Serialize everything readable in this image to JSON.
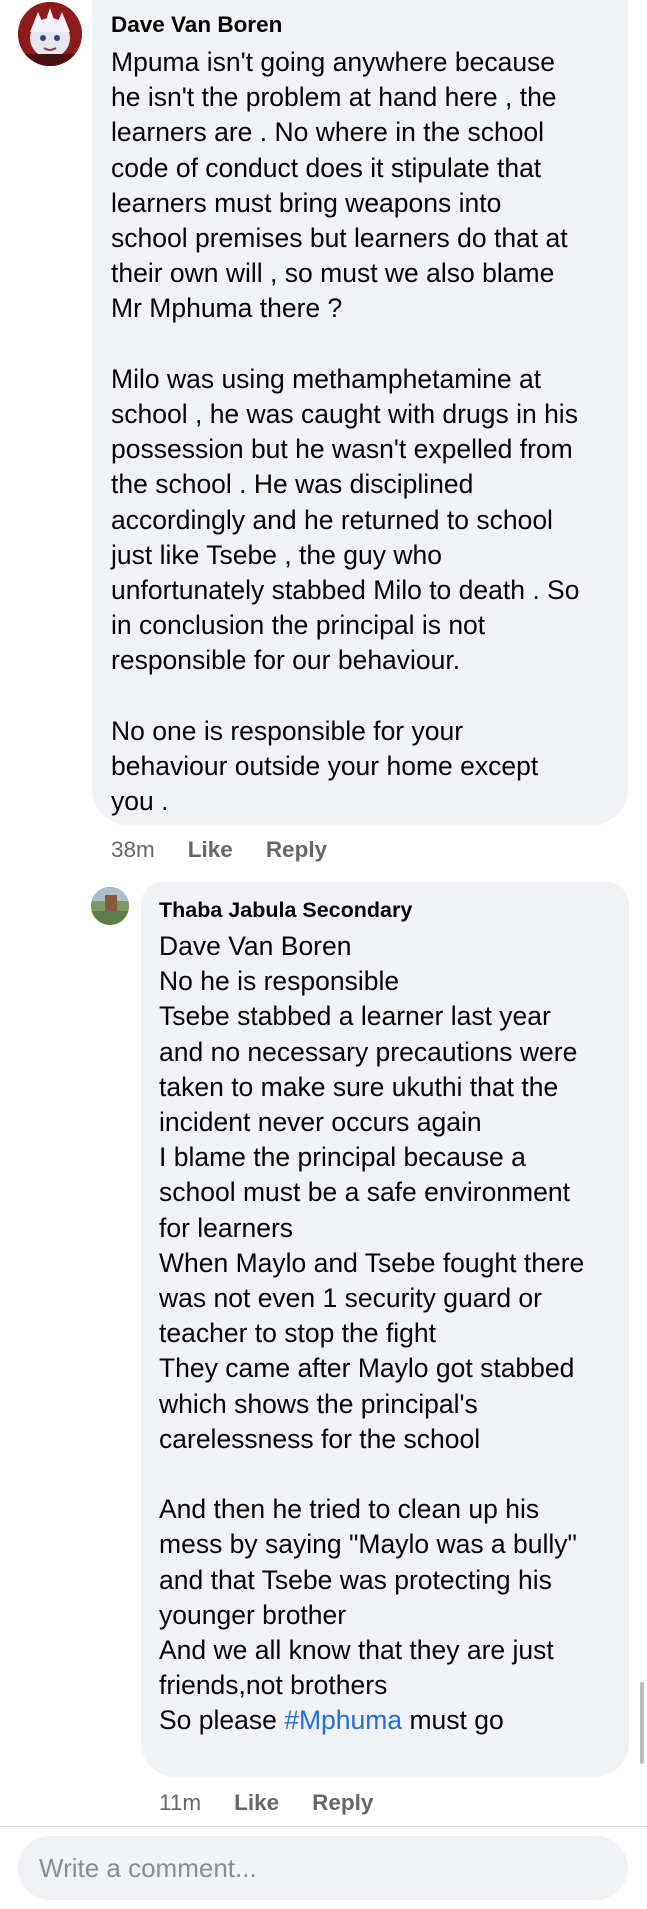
{
  "comments": [
    {
      "author": "Dave Van Boren",
      "body": "Mpuma isn't going anywhere because\nhe isn't the problem at hand here , the\nlearners are . No where in the school\ncode of conduct does it stipulate that\nlearners must bring weapons into\nschool premises but learners do that at\ntheir own will , so must we also blame\nMr Mphuma there ?\n\nMilo was using methamphetamine at\nschool , he was caught with drugs in his\npossession but he wasn't expelled from\nthe school . He was disciplined\naccordingly and he returned to school\njust like Tsebe , the guy who\nunfortunately stabbed Milo to death . So\nin conclusion the principal is not\nresponsible for our behaviour.\n\nNo one is responsible for your\nbehaviour outside your home except\nyou .",
      "time": "38m",
      "like_label": "Like",
      "reply_label": "Reply"
    }
  ],
  "reply": {
    "author": "Thaba Jabula Secondary",
    "body": "Dave Van Boren\nNo he is responsible\nTsebe stabbed a learner last year\nand no necessary precautions were\ntaken to make sure ukuthi that the\nincident never occurs again\nI blame the principal because a\nschool must be a safe environment\nfor learners\nWhen Maylo and Tsebe fought there\nwas not even 1 security guard or\nteacher to stop the fight\nThey came after Maylo got stabbed\nwhich shows the principal's\ncarelessness for the school\n\nAnd then he tried to clean up his\nmess by saying \"Maylo was a bully\"\nand that Tsebe was protecting his\nyounger brother\nAnd we all know that they are just\nfriends,not brothers\n",
    "last_line_prefix": "So please ",
    "hashtag": "#Mphuma",
    "last_line_suffix": " must go",
    "time": "11m",
    "like_label": "Like",
    "reply_label": "Reply"
  },
  "composer": {
    "placeholder": "Write a comment..."
  },
  "colors": {
    "bubble": "#f0f2f5",
    "meta_text": "#65676b",
    "hashtag": "#216fdb"
  }
}
